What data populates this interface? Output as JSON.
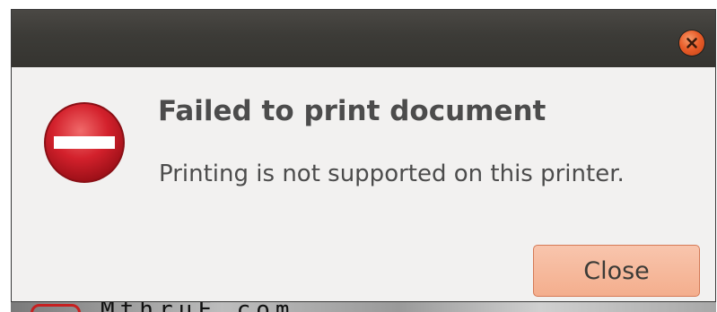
{
  "dialog": {
    "heading": "Failed to print document",
    "message": "Printing is not supported on this printer.",
    "close_button_label": "Close",
    "icons": {
      "titlebar_close": "close-icon",
      "status": "error-icon"
    }
  },
  "background": {
    "partial_text": "MthruF.com"
  },
  "colors": {
    "titlebar": "#3c3b37",
    "dialog_bg": "#f2f1f0",
    "close_accent": "#e95420",
    "error_red": "#d0202b",
    "button_bg": "#f4ae8d",
    "text": "#4c4c4c"
  }
}
